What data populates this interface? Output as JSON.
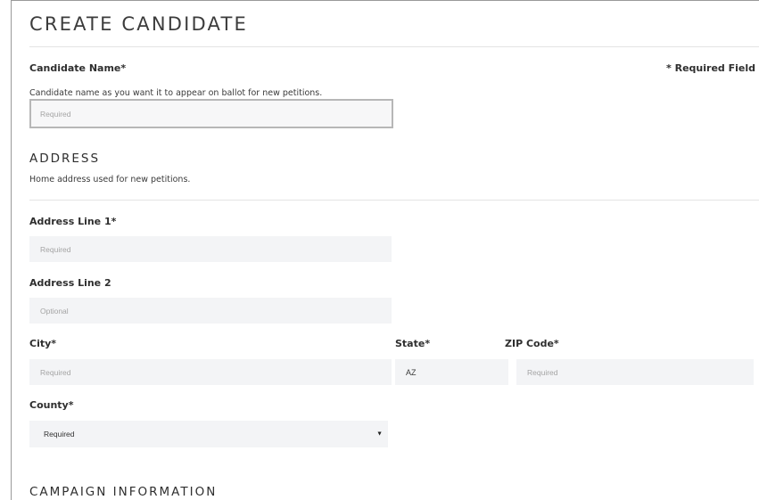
{
  "page": {
    "title": "CREATE CANDIDATE",
    "required_note": "* Required Field"
  },
  "candidate": {
    "name_label": "Candidate Name*",
    "help": "Candidate name as you want it to appear on ballot for new petitions.",
    "placeholder": "Required"
  },
  "address": {
    "title": "ADDRESS",
    "help": "Home address used for new petitions.",
    "line1_label": "Address Line 1*",
    "line1_placeholder": "Required",
    "line2_label": "Address Line 2",
    "line2_placeholder": "Optional",
    "city_label": "City*",
    "city_placeholder": "Required",
    "state_label": "State*",
    "state_value": "AZ",
    "zip_label": "ZIP Code*",
    "zip_placeholder": "Required",
    "county_label": "County*",
    "county_selected": "Required"
  },
  "campaign": {
    "title": "CAMPAIGN INFORMATION"
  },
  "icons": {
    "county_caret": "caret-down-icon"
  }
}
